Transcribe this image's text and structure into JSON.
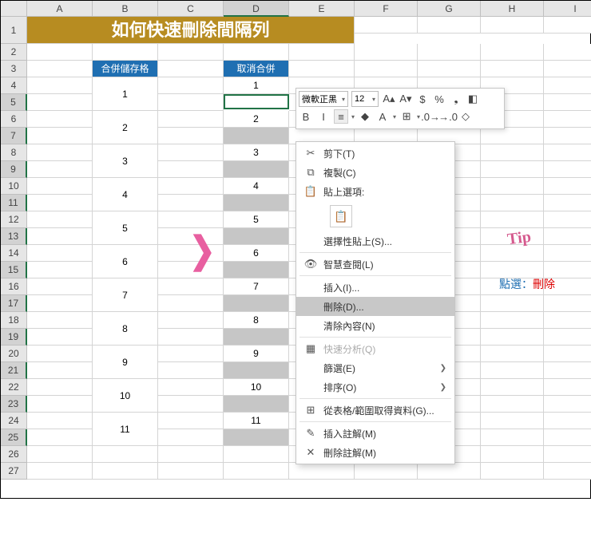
{
  "columns": [
    "A",
    "B",
    "C",
    "D",
    "E",
    "F",
    "G",
    "H",
    "I"
  ],
  "col_widths": [
    "cA",
    "cB",
    "cC",
    "cD",
    "cE",
    "cF",
    "cG",
    "cH",
    "cI"
  ],
  "selected_col": "D",
  "title": "如何快速刪除間隔列",
  "headers": {
    "b": "合併儲存格",
    "d": "取消合併"
  },
  "merged_values": [
    "1",
    "2",
    "3",
    "4",
    "5",
    "6",
    "7",
    "8",
    "9",
    "10",
    "11"
  ],
  "unmerged_values": [
    "1",
    "2",
    "3",
    "4",
    "5",
    "6",
    "7",
    "8",
    "9",
    "10",
    "11"
  ],
  "selected_rows": [
    5,
    7,
    9,
    11,
    13,
    15,
    17,
    19,
    21,
    23,
    25
  ],
  "mini_toolbar": {
    "font": "微軟正黑",
    "size": "12",
    "icons_row1": [
      {
        "name": "increase-font-icon",
        "glyph": "A▴"
      },
      {
        "name": "decrease-font-icon",
        "glyph": "A▾"
      },
      {
        "name": "currency-icon",
        "glyph": "$"
      },
      {
        "name": "percent-icon",
        "glyph": "%"
      },
      {
        "name": "comma-icon",
        "glyph": "❟"
      },
      {
        "name": "format-painter-icon",
        "glyph": "◧"
      }
    ],
    "icons_row2": [
      {
        "name": "bold-icon",
        "glyph": "B"
      },
      {
        "name": "italic-icon",
        "glyph": "I"
      },
      {
        "name": "align-center-icon",
        "glyph": "≡",
        "boxed": true
      },
      {
        "name": "fill-color-icon",
        "glyph": "◆"
      },
      {
        "name": "font-color-icon",
        "glyph": "A"
      },
      {
        "name": "border-icon",
        "glyph": "⊞"
      },
      {
        "name": "increase-decimal-icon",
        "glyph": ".0→"
      },
      {
        "name": "decrease-decimal-icon",
        "glyph": "→.0"
      },
      {
        "name": "clear-format-icon",
        "glyph": "◇"
      }
    ]
  },
  "context_menu": [
    {
      "type": "item",
      "icon": "✂",
      "name": "cut-menu",
      "label": "剪下(T)"
    },
    {
      "type": "item",
      "icon": "⧉",
      "name": "copy-menu",
      "label": "複製(C)"
    },
    {
      "type": "item",
      "icon": "📋",
      "name": "paste-options-menu",
      "label": "貼上選項:"
    },
    {
      "type": "paste-opt"
    },
    {
      "type": "item",
      "icon": "",
      "name": "paste-special-menu",
      "label": "選擇性貼上(S)..."
    },
    {
      "type": "sep"
    },
    {
      "type": "item",
      "icon": "👁",
      "name": "smart-lookup-menu",
      "label": "智慧查閱(L)"
    },
    {
      "type": "sep"
    },
    {
      "type": "item",
      "icon": "",
      "name": "insert-menu",
      "label": "插入(I)..."
    },
    {
      "type": "item",
      "icon": "",
      "name": "delete-menu",
      "label": "刪除(D)...",
      "hi": true
    },
    {
      "type": "item",
      "icon": "",
      "name": "clear-contents-menu",
      "label": "清除內容(N)"
    },
    {
      "type": "sep"
    },
    {
      "type": "item",
      "icon": "▦",
      "name": "quick-analysis-menu",
      "label": "快速分析(Q)",
      "disabled": true
    },
    {
      "type": "item",
      "icon": "",
      "name": "filter-menu",
      "label": "篩選(E)",
      "arrow": true
    },
    {
      "type": "item",
      "icon": "",
      "name": "sort-menu",
      "label": "排序(O)",
      "arrow": true
    },
    {
      "type": "sep"
    },
    {
      "type": "item",
      "icon": "⊞",
      "name": "get-table-data-menu",
      "label": "從表格/範圍取得資料(G)..."
    },
    {
      "type": "sep"
    },
    {
      "type": "item",
      "icon": "✎",
      "name": "insert-comment-menu",
      "label": "插入註解(M)"
    },
    {
      "type": "item",
      "icon": "✕",
      "name": "delete-comment-menu",
      "label": "刪除註解(M)"
    }
  ],
  "tip": {
    "word": "Tip",
    "label": "點選：",
    "value": "刪除"
  }
}
